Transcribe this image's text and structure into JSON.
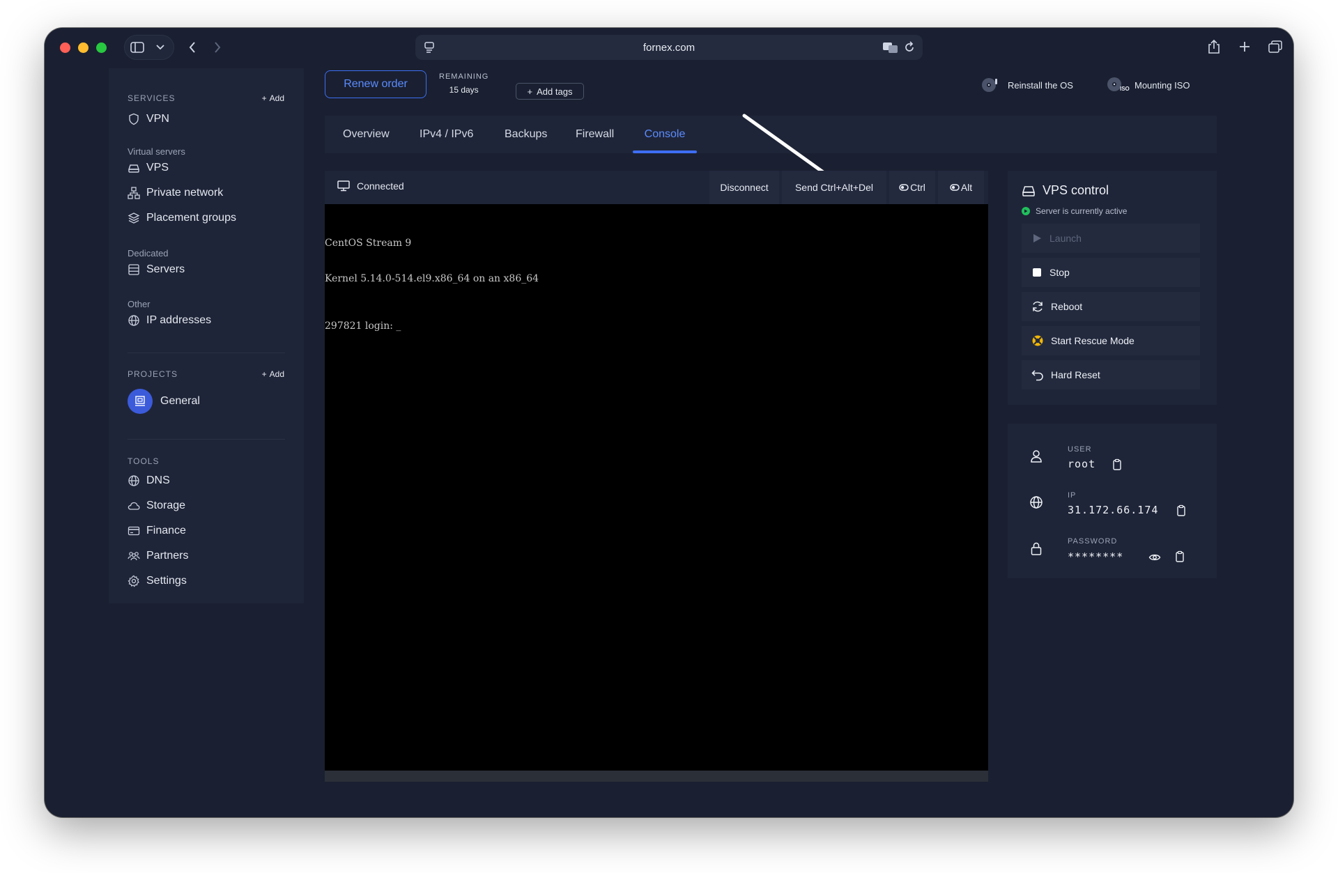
{
  "browser": {
    "url": "fornex.com"
  },
  "sidebar": {
    "services_header": "SERVICES",
    "services_add": "Add",
    "vpn": "VPN",
    "virtual_servers_label": "Virtual servers",
    "vps": "VPS",
    "private_network": "Private network",
    "placement_groups": "Placement groups",
    "dedicated_label": "Dedicated",
    "servers": "Servers",
    "other_label": "Other",
    "ip_addresses": "IP addresses",
    "projects_header": "PROJECTS",
    "projects_add": "Add",
    "project_general": "General",
    "tools_header": "TOOLS",
    "dns": "DNS",
    "storage": "Storage",
    "finance": "Finance",
    "partners": "Partners",
    "settings": "Settings"
  },
  "header": {
    "renew_order": "Renew order",
    "remaining_label": "REMAINING",
    "remaining_value": "15 days",
    "add_tags": "Add tags",
    "reinstall_os": "Reinstall the OS",
    "mounting_iso": "Mounting ISO",
    "iso_badge": "ISO"
  },
  "tabs": [
    {
      "label": "Overview"
    },
    {
      "label": "IPv4 / IPv6"
    },
    {
      "label": "Backups"
    },
    {
      "label": "Firewall"
    },
    {
      "label": "Console"
    }
  ],
  "console": {
    "status": "Connected",
    "disconnect": "Disconnect",
    "send_cad": "Send Ctrl+Alt+Del",
    "ctrl": "Ctrl",
    "alt": "Alt",
    "line1": "CentOS Stream 9",
    "line2": "Kernel 5.14.0-514.el9.x86_64 on an x86_64",
    "line3": "297821 login: _"
  },
  "vps_control": {
    "title": "VPS control",
    "status": "Server is currently active",
    "launch": "Launch",
    "stop": "Stop",
    "reboot": "Reboot",
    "rescue": "Start Rescue Mode",
    "hard_reset": "Hard Reset"
  },
  "credentials": {
    "user_label": "USER",
    "user_value": "root",
    "ip_label": "IP",
    "ip_value": "31.172.66.174",
    "password_label": "PASSWORD",
    "password_value": "********"
  },
  "colors": {
    "background": "#1a2031",
    "panel": "#1f2538",
    "accent": "#3d6ef5",
    "active_status": "#20c05c"
  }
}
